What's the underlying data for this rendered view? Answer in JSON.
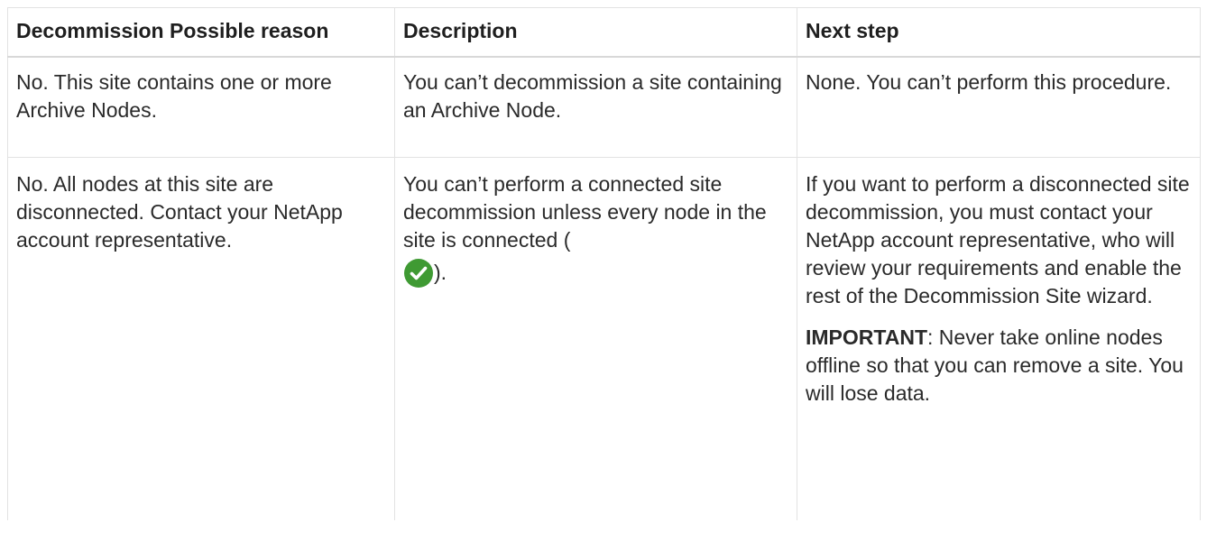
{
  "table": {
    "headers": [
      "Decommission Possible reason",
      "Description",
      "Next step"
    ],
    "rows": [
      {
        "reason": "No. This site contains one or more Archive Nodes.",
        "description": "You can’t decommission a site containing an Archive Node.",
        "next_step": "None. You can’t perform this procedure."
      },
      {
        "reason": "No. All nodes at this site are disconnected. Contact your NetApp account representative.",
        "description_before_icon": "You can’t perform a connected site decommission unless every node in the site is connected (",
        "description_icon": "connected-check-icon",
        "description_after_icon": ").",
        "next_step": "If you want to perform a disconnected site decommission, you must contact your NetApp account representative, who will review your requirements and enable the rest of the Decommission Site wizard.",
        "important_label": "IMPORTANT",
        "important_text": ": Never take online nodes offline so that you can remove a site. You will lose data."
      }
    ]
  },
  "colors": {
    "check_icon": "#3f9a33",
    "border": "#e2e2e2",
    "text": "#2a2a2a"
  }
}
